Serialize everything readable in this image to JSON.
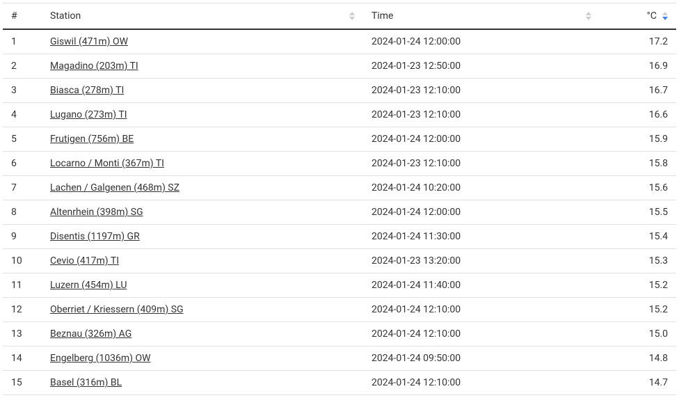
{
  "table": {
    "headers": {
      "num": "#",
      "station": "Station",
      "time": "Time",
      "temp": "°C"
    },
    "rows": [
      {
        "num": "1",
        "station": "Giswil (471m) OW",
        "time": "2024-01-24 12:00:00",
        "temp": "17.2"
      },
      {
        "num": "2",
        "station": "Magadino (203m) TI",
        "time": "2024-01-23 12:50:00",
        "temp": "16.9"
      },
      {
        "num": "3",
        "station": "Biasca (278m) TI",
        "time": "2024-01-23 12:10:00",
        "temp": "16.7"
      },
      {
        "num": "4",
        "station": "Lugano (273m) TI",
        "time": "2024-01-23 12:10:00",
        "temp": "16.6"
      },
      {
        "num": "5",
        "station": "Frutigen (756m) BE",
        "time": "2024-01-24 12:00:00",
        "temp": "15.9"
      },
      {
        "num": "6",
        "station": "Locarno / Monti (367m) TI",
        "time": "2024-01-23 12:10:00",
        "temp": "15.8"
      },
      {
        "num": "7",
        "station": "Lachen / Galgenen (468m) SZ",
        "time": "2024-01-24 10:20:00",
        "temp": "15.6"
      },
      {
        "num": "8",
        "station": "Altenrhein (398m) SG",
        "time": "2024-01-24 12:00:00",
        "temp": "15.5"
      },
      {
        "num": "9",
        "station": "Disentis (1197m) GR",
        "time": "2024-01-24 11:30:00",
        "temp": "15.4"
      },
      {
        "num": "10",
        "station": "Cevio (417m) TI",
        "time": "2024-01-23 13:20:00",
        "temp": "15.3"
      },
      {
        "num": "11",
        "station": "Luzern (454m) LU",
        "time": "2024-01-24 11:40:00",
        "temp": "15.2"
      },
      {
        "num": "12",
        "station": "Oberriet / Kriessern (409m) SG",
        "time": "2024-01-24 12:10:00",
        "temp": "15.2"
      },
      {
        "num": "13",
        "station": "Beznau (326m) AG",
        "time": "2024-01-24 12:10:00",
        "temp": "15.0"
      },
      {
        "num": "14",
        "station": "Engelberg (1036m) OW",
        "time": "2024-01-24 09:50:00",
        "temp": "14.8"
      },
      {
        "num": "15",
        "station": "Basel (316m) BL",
        "time": "2024-01-24 12:10:00",
        "temp": "14.7"
      }
    ]
  }
}
